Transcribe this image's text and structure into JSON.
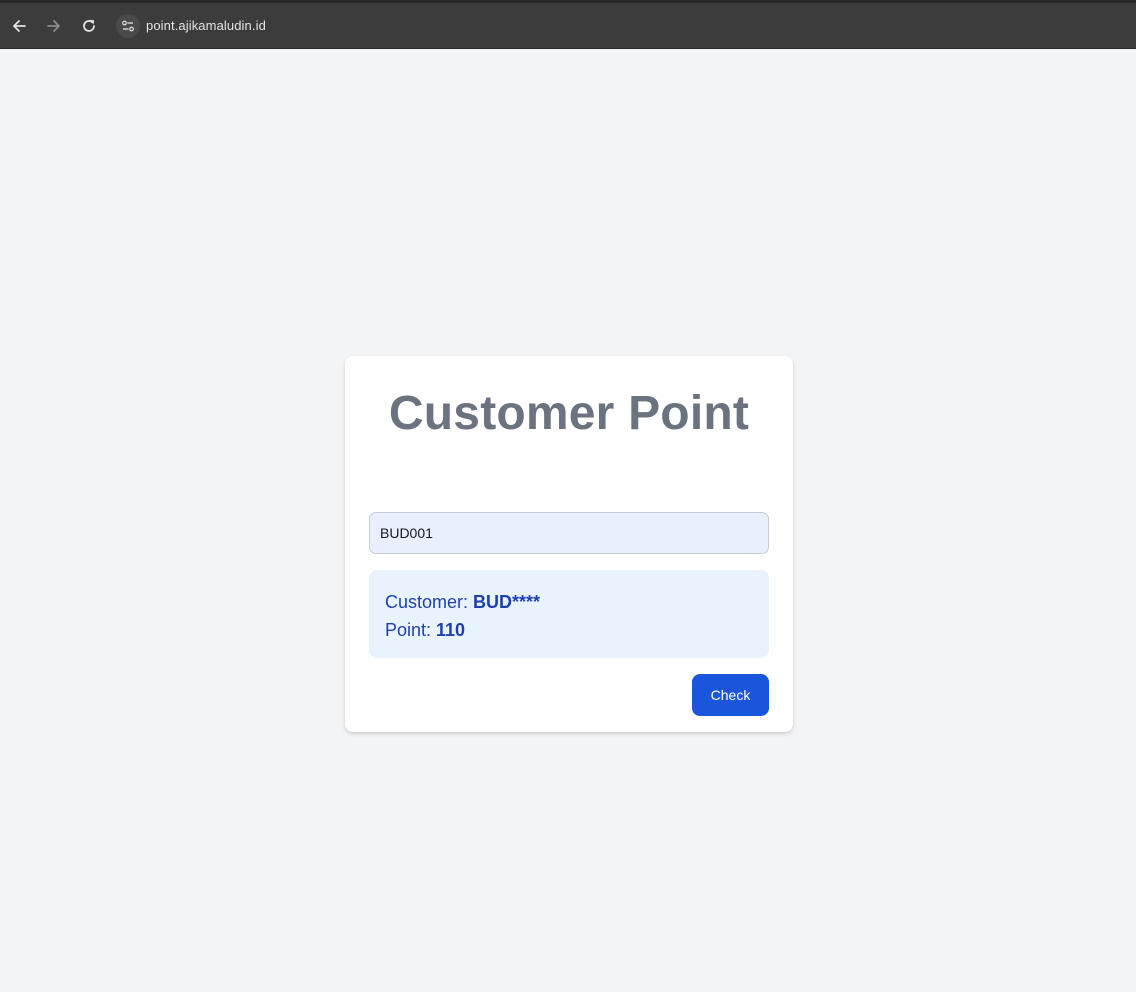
{
  "browser": {
    "url": "point.ajikamaludin.id",
    "icons": [
      "back-arrow-icon",
      "forward-arrow-icon",
      "reload-icon",
      "site-settings-icon"
    ]
  },
  "card": {
    "title": "Customer Point",
    "input": {
      "value": "BUD001",
      "placeholder": ""
    },
    "result": {
      "customer_label": "Customer: ",
      "customer_value": "BUD****",
      "point_label": "Point: ",
      "point_value": "110"
    },
    "check_label": "Check"
  },
  "colors": {
    "page_background": "#f3f4f6",
    "title": "#6b7280",
    "result_text": "#1e40af",
    "result_background": "#e9f3fe",
    "button": "#1a56db",
    "input_background": "#e8f0fe"
  }
}
